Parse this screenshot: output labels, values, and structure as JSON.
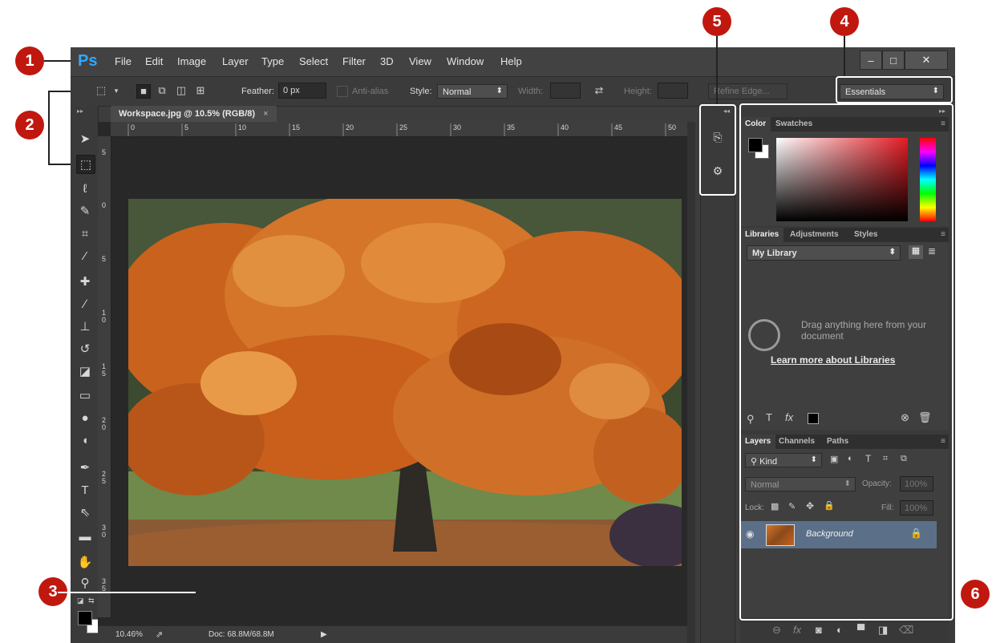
{
  "callouts": [
    "1",
    "2",
    "3",
    "4",
    "5",
    "6"
  ],
  "menubar": {
    "logo": "Ps",
    "items": [
      "File",
      "Edit",
      "Image",
      "Layer",
      "Type",
      "Select",
      "Filter",
      "3D",
      "View",
      "Window",
      "Help"
    ],
    "window_controls": {
      "minimize": "–",
      "maximize": "□",
      "close": "✕"
    }
  },
  "options": {
    "feather_label": "Feather:",
    "feather_value": "0 px",
    "antialias_label": "Anti-alias",
    "style_label": "Style:",
    "style_value": "Normal",
    "width_label": "Width:",
    "swap_icon": "⇄",
    "height_label": "Height:",
    "refine_edge": "Refine Edge...",
    "workspace": "Essentials"
  },
  "document": {
    "tab_title": "Workspace.jpg @ 10.5% (RGB/8)",
    "close": "×",
    "ruler_top": [
      "0",
      "5",
      "10",
      "15",
      "20",
      "25",
      "30",
      "35",
      "40",
      "45",
      "50"
    ],
    "ruler_left": [
      "5",
      "0",
      "5",
      "1\n0",
      "1\n5",
      "2\n0",
      "2\n5",
      "3\n0",
      "3\n5"
    ]
  },
  "statusbar": {
    "zoom": "10.46%",
    "doc": "Doc: 68.8M/68.8M",
    "play": "▶"
  },
  "toolbar_icons": [
    "move-icon",
    "marquee-icon",
    "lasso-icon",
    "quick-select-icon",
    "crop-icon",
    "eyedropper-icon",
    "healing-brush-icon",
    "brush-icon",
    "clone-stamp-icon",
    "history-brush-icon",
    "eraser-icon",
    "gradient-icon",
    "blur-icon",
    "dodge-icon",
    "pen-icon",
    "type-icon",
    "path-selection-icon",
    "rectangle-icon",
    "hand-icon",
    "zoom-icon"
  ],
  "color_panel": {
    "tabs": [
      "Color",
      "Swatches"
    ]
  },
  "libraries_panel": {
    "tabs": [
      "Libraries",
      "Adjustments",
      "Styles"
    ],
    "library_select": "My Library",
    "empty_text": "Drag anything here from your document",
    "learn_link": "Learn more about Libraries"
  },
  "layers_panel": {
    "tabs": [
      "Layers",
      "Channels",
      "Paths"
    ],
    "kind": "Kind",
    "blend_mode": "Normal",
    "opacity_label": "Opacity:",
    "opacity_value": "100%",
    "lock_label": "Lock:",
    "fill_label": "Fill:",
    "fill_value": "100%",
    "layer_name": "Background"
  },
  "colors": {
    "callout": "#c0180f",
    "app_bg": "#3d3d3d",
    "layer_selected": "#5b7088",
    "ps_blue": "#31a8ff"
  }
}
